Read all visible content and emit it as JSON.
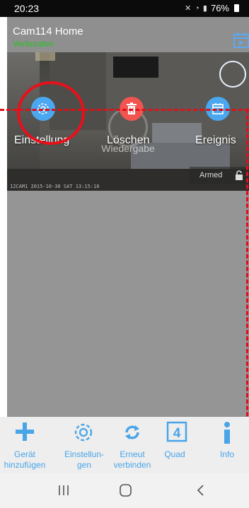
{
  "status_bar": {
    "time": "20:23",
    "battery": "76%",
    "icons": [
      "mute-icon",
      "wifi-icon",
      "signal-icon",
      "battery-icon"
    ]
  },
  "header": {
    "title": "Cam114 Home",
    "status": "Verbunden",
    "status_color": "#25c21f"
  },
  "video": {
    "overlay_buttons": [
      {
        "label": "Einstellung",
        "icon": "gear-icon",
        "color": "#4aa7f0"
      },
      {
        "label": "Löschen",
        "icon": "trash-icon",
        "color": "#f25450"
      },
      {
        "label": "Ereignis",
        "icon": "calendar-icon",
        "color": "#4aa7f0"
      }
    ],
    "playback_label": "Wiedergabe",
    "armed_label": "Armed",
    "timestamp": "12CAM1 2015-10-30 SAT 13:15:10"
  },
  "toolbar": {
    "items": [
      {
        "label": "Gerät hinzufügen",
        "icon": "plus-icon"
      },
      {
        "label": "Einstellun- gen",
        "icon": "gear-icon"
      },
      {
        "label": "Erneut verbinden",
        "icon": "refresh-icon"
      },
      {
        "label": "Quad",
        "icon": "quad-icon",
        "badge": "4"
      },
      {
        "label": "Info",
        "icon": "info-icon"
      }
    ],
    "accent_color": "#49a4e8"
  },
  "nav_bar": {
    "buttons": [
      "recents-icon",
      "home-icon",
      "back-icon"
    ]
  },
  "annotation_color": "#e8101a"
}
